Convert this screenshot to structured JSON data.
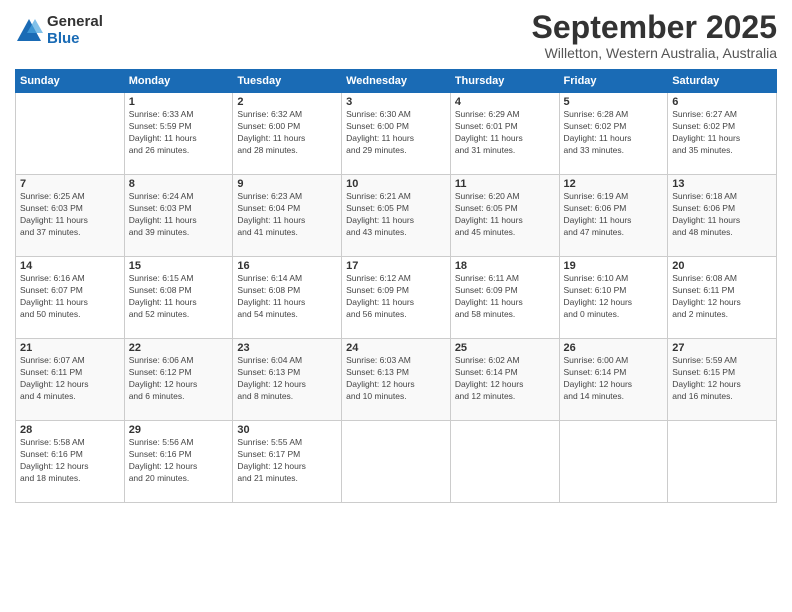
{
  "logo": {
    "general": "General",
    "blue": "Blue"
  },
  "title": "September 2025",
  "subtitle": "Willetton, Western Australia, Australia",
  "days_header": [
    "Sunday",
    "Monday",
    "Tuesday",
    "Wednesday",
    "Thursday",
    "Friday",
    "Saturday"
  ],
  "weeks": [
    [
      {
        "day": "",
        "content": ""
      },
      {
        "day": "1",
        "content": "Sunrise: 6:33 AM\nSunset: 5:59 PM\nDaylight: 11 hours\nand 26 minutes."
      },
      {
        "day": "2",
        "content": "Sunrise: 6:32 AM\nSunset: 6:00 PM\nDaylight: 11 hours\nand 28 minutes."
      },
      {
        "day": "3",
        "content": "Sunrise: 6:30 AM\nSunset: 6:00 PM\nDaylight: 11 hours\nand 29 minutes."
      },
      {
        "day": "4",
        "content": "Sunrise: 6:29 AM\nSunset: 6:01 PM\nDaylight: 11 hours\nand 31 minutes."
      },
      {
        "day": "5",
        "content": "Sunrise: 6:28 AM\nSunset: 6:02 PM\nDaylight: 11 hours\nand 33 minutes."
      },
      {
        "day": "6",
        "content": "Sunrise: 6:27 AM\nSunset: 6:02 PM\nDaylight: 11 hours\nand 35 minutes."
      }
    ],
    [
      {
        "day": "7",
        "content": "Sunrise: 6:25 AM\nSunset: 6:03 PM\nDaylight: 11 hours\nand 37 minutes."
      },
      {
        "day": "8",
        "content": "Sunrise: 6:24 AM\nSunset: 6:03 PM\nDaylight: 11 hours\nand 39 minutes."
      },
      {
        "day": "9",
        "content": "Sunrise: 6:23 AM\nSunset: 6:04 PM\nDaylight: 11 hours\nand 41 minutes."
      },
      {
        "day": "10",
        "content": "Sunrise: 6:21 AM\nSunset: 6:05 PM\nDaylight: 11 hours\nand 43 minutes."
      },
      {
        "day": "11",
        "content": "Sunrise: 6:20 AM\nSunset: 6:05 PM\nDaylight: 11 hours\nand 45 minutes."
      },
      {
        "day": "12",
        "content": "Sunrise: 6:19 AM\nSunset: 6:06 PM\nDaylight: 11 hours\nand 47 minutes."
      },
      {
        "day": "13",
        "content": "Sunrise: 6:18 AM\nSunset: 6:06 PM\nDaylight: 11 hours\nand 48 minutes."
      }
    ],
    [
      {
        "day": "14",
        "content": "Sunrise: 6:16 AM\nSunset: 6:07 PM\nDaylight: 11 hours\nand 50 minutes."
      },
      {
        "day": "15",
        "content": "Sunrise: 6:15 AM\nSunset: 6:08 PM\nDaylight: 11 hours\nand 52 minutes."
      },
      {
        "day": "16",
        "content": "Sunrise: 6:14 AM\nSunset: 6:08 PM\nDaylight: 11 hours\nand 54 minutes."
      },
      {
        "day": "17",
        "content": "Sunrise: 6:12 AM\nSunset: 6:09 PM\nDaylight: 11 hours\nand 56 minutes."
      },
      {
        "day": "18",
        "content": "Sunrise: 6:11 AM\nSunset: 6:09 PM\nDaylight: 11 hours\nand 58 minutes."
      },
      {
        "day": "19",
        "content": "Sunrise: 6:10 AM\nSunset: 6:10 PM\nDaylight: 12 hours\nand 0 minutes."
      },
      {
        "day": "20",
        "content": "Sunrise: 6:08 AM\nSunset: 6:11 PM\nDaylight: 12 hours\nand 2 minutes."
      }
    ],
    [
      {
        "day": "21",
        "content": "Sunrise: 6:07 AM\nSunset: 6:11 PM\nDaylight: 12 hours\nand 4 minutes."
      },
      {
        "day": "22",
        "content": "Sunrise: 6:06 AM\nSunset: 6:12 PM\nDaylight: 12 hours\nand 6 minutes."
      },
      {
        "day": "23",
        "content": "Sunrise: 6:04 AM\nSunset: 6:13 PM\nDaylight: 12 hours\nand 8 minutes."
      },
      {
        "day": "24",
        "content": "Sunrise: 6:03 AM\nSunset: 6:13 PM\nDaylight: 12 hours\nand 10 minutes."
      },
      {
        "day": "25",
        "content": "Sunrise: 6:02 AM\nSunset: 6:14 PM\nDaylight: 12 hours\nand 12 minutes."
      },
      {
        "day": "26",
        "content": "Sunrise: 6:00 AM\nSunset: 6:14 PM\nDaylight: 12 hours\nand 14 minutes."
      },
      {
        "day": "27",
        "content": "Sunrise: 5:59 AM\nSunset: 6:15 PM\nDaylight: 12 hours\nand 16 minutes."
      }
    ],
    [
      {
        "day": "28",
        "content": "Sunrise: 5:58 AM\nSunset: 6:16 PM\nDaylight: 12 hours\nand 18 minutes."
      },
      {
        "day": "29",
        "content": "Sunrise: 5:56 AM\nSunset: 6:16 PM\nDaylight: 12 hours\nand 20 minutes."
      },
      {
        "day": "30",
        "content": "Sunrise: 5:55 AM\nSunset: 6:17 PM\nDaylight: 12 hours\nand 21 minutes."
      },
      {
        "day": "",
        "content": ""
      },
      {
        "day": "",
        "content": ""
      },
      {
        "day": "",
        "content": ""
      },
      {
        "day": "",
        "content": ""
      }
    ]
  ]
}
